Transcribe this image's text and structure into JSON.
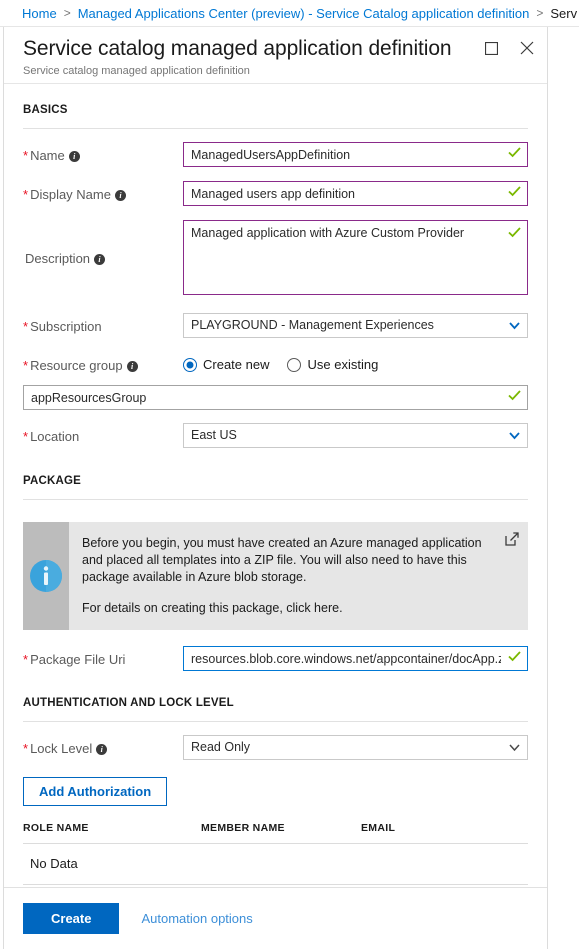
{
  "breadcrumb": {
    "items": [
      {
        "label": "Home"
      },
      {
        "label": "Managed Applications Center (preview) - Service Catalog application definition"
      },
      {
        "label": "Serv"
      }
    ],
    "separator": ">"
  },
  "blade": {
    "title": "Service catalog managed application definition",
    "subtitle": "Service catalog managed application definition",
    "maximize_icon": "maximize-icon",
    "close_icon": "close-icon"
  },
  "sections": {
    "basics": {
      "heading": "BASICS"
    },
    "package": {
      "heading": "PACKAGE"
    },
    "auth": {
      "heading": "AUTHENTICATION AND LOCK LEVEL"
    }
  },
  "fields": {
    "name": {
      "label": "Name",
      "required": "*",
      "info_icon": "info-icon",
      "value": "ManagedUsersAppDefinition",
      "placeholder": "",
      "valid_icon": "checkmark-icon"
    },
    "display_name": {
      "label": "Display Name",
      "required": "*",
      "info_icon": "info-icon",
      "value": "Managed users app definition",
      "placeholder": "",
      "valid_icon": "checkmark-icon"
    },
    "description": {
      "label": "Description",
      "required": "",
      "info_icon": "info-icon",
      "value": "Managed application with Azure Custom Provider",
      "placeholder": "",
      "valid_icon": "checkmark-icon"
    },
    "subscription": {
      "label": "Subscription",
      "required": "*",
      "value": "PLAYGROUND - Management Experiences",
      "caret_icon": "chevron-down-icon"
    },
    "resource_group": {
      "label": "Resource group",
      "required": "*",
      "info_icon": "info-icon",
      "options": [
        {
          "label": "Create new",
          "selected": true
        },
        {
          "label": "Use existing",
          "selected": false
        }
      ],
      "value": "appResourcesGroup",
      "valid_icon": "checkmark-icon"
    },
    "location": {
      "label": "Location",
      "required": "*",
      "value": "East US",
      "caret_icon": "chevron-down-icon"
    },
    "package_file_uri": {
      "label": "Package File Uri",
      "required": "*",
      "value": "resources.blob.core.windows.net/appcontainer/docApp.zip",
      "placeholder": "",
      "valid_icon": "checkmark-icon"
    },
    "lock_level": {
      "label": "Lock Level",
      "required": "*",
      "info_icon": "info-icon",
      "value": "Read Only",
      "caret_icon": "chevron-down-icon"
    }
  },
  "banner": {
    "icon": "info-circle-icon",
    "text": "Before you begin, you must have created an Azure managed application and placed all templates into a ZIP file. You will also need to have this package available in Azure blob storage.",
    "text2": "For details on creating this package, click here.",
    "external_link_icon": "external-link-icon"
  },
  "authorization": {
    "add_button": "Add Authorization",
    "table": {
      "columns": [
        "ROLE NAME",
        "MEMBER NAME",
        "EMAIL"
      ],
      "empty_text": "No Data"
    }
  },
  "footer": {
    "create_label": "Create",
    "automation_label": "Automation options"
  },
  "colors": {
    "accent": "#0067c0",
    "link": "#0078d4",
    "valid_border": "#8a2a8a",
    "valid_check": "#7ab800",
    "required_star": "#e81123",
    "focus_border": "#0078d4",
    "banner_bg": "#e6e6e6",
    "banner_icon_bg": "#bcbcbc",
    "banner_icon": "#3aa3dc"
  }
}
